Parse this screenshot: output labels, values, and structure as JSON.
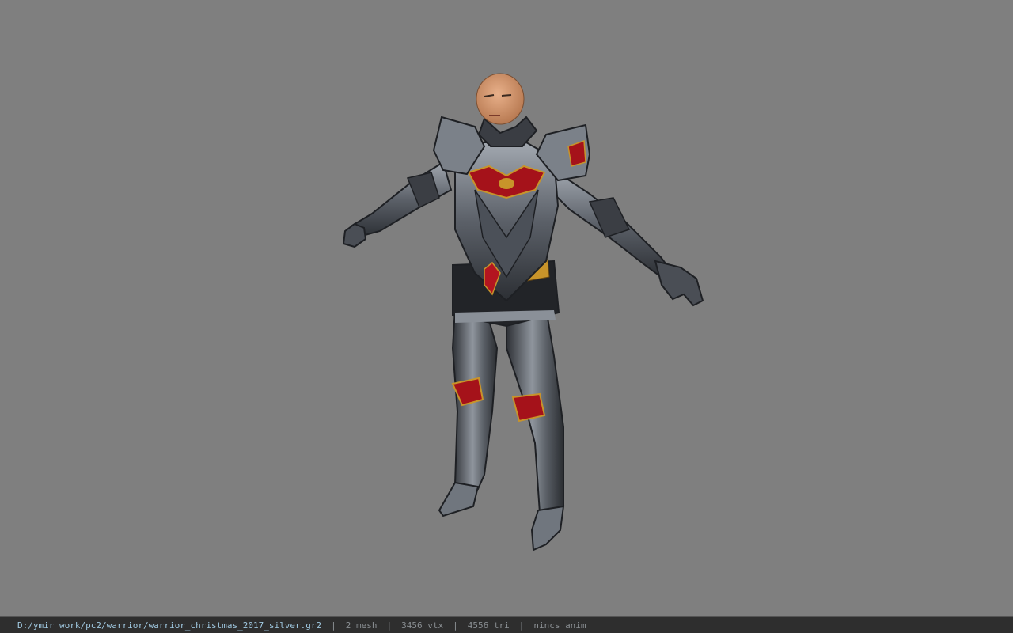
{
  "status_bar": {
    "file_path": "D:/ymir work/pc2/warrior/warrior_christmas_2017_silver.gr2",
    "separator": "|",
    "mesh_count": "2 mesh",
    "vertex_count": "3456 vtx",
    "triangle_count": "4556 tri",
    "animation": "nincs anim"
  },
  "colors": {
    "viewport_background": "#7f7f7f",
    "status_bar_background": "#2e2e2e",
    "path_text": "#9fc7df",
    "stat_text": "#8a8f93",
    "armor_dark": "#3a3d43",
    "armor_light": "#9aa0a8",
    "armor_accent_red": "#a5121a",
    "armor_accent_gold": "#c8942a",
    "skin": "#d89a6e"
  },
  "viewport": {
    "model_icon": "armored-warrior-model"
  }
}
